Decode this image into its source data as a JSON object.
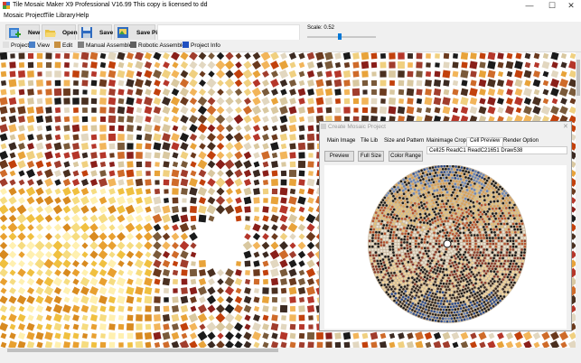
{
  "window": {
    "title": "Tile Mosaic Maker X9 Professional V16.99   This copy is licensed to dd",
    "controls": {
      "minimize": "—",
      "maximize": "☐",
      "close": "✕"
    }
  },
  "menu": [
    "Mosaic Project",
    "Tile Library",
    "Help"
  ],
  "toolbar": {
    "new_label": "New",
    "open_label": "Open",
    "save_label": "Save",
    "savepic_label": "Save Pic",
    "scale_label": "Scale: 0.52",
    "scale_value": 0.52
  },
  "toolstrip": [
    "Project",
    "View",
    "Edit",
    "Manual Assemble",
    "Robotic Assemble",
    "Project Info"
  ],
  "dialog": {
    "title": "Create Mosaic Project",
    "close": "✕",
    "tabs": [
      "Main Image",
      "Tile Lib",
      "Size and Pattern",
      "Mainimage Crop",
      "Cell Preview",
      "Render Option"
    ],
    "active_tab": "Cell Preview",
    "buttons": {
      "preview": "Preview",
      "fullsize": "Full Size",
      "colorrange": "Color Range"
    },
    "status": "Cell25 ReadC1 ReadC21651  Draw538"
  },
  "colors": {
    "accent": "#0078d7",
    "chrome": "#f0f0f0"
  }
}
